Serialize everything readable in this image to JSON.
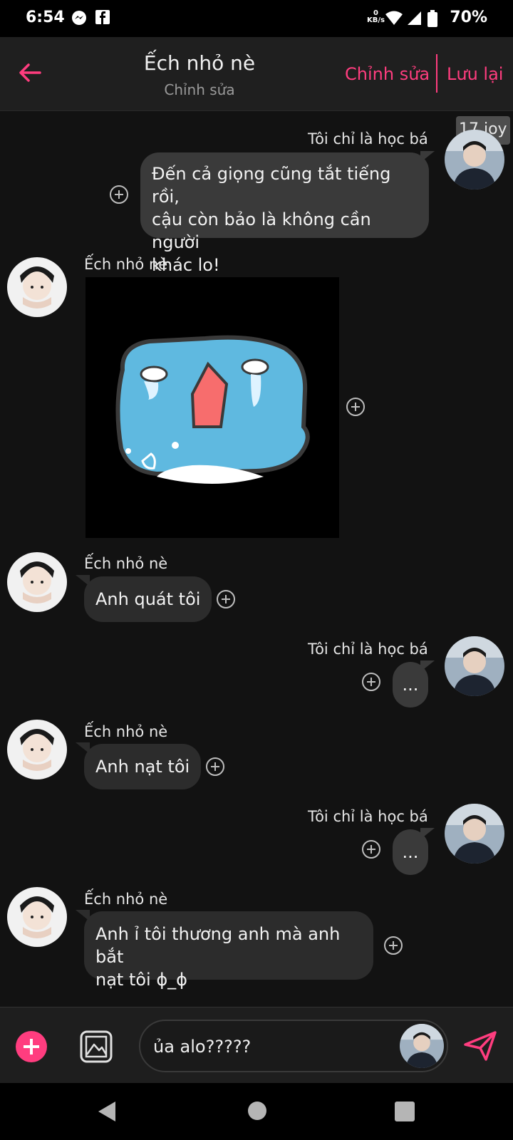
{
  "status_bar": {
    "time": "6:54",
    "net_value": "0",
    "net_unit": "KB/s",
    "battery": "70%"
  },
  "header": {
    "title": "Ếch nhỏ nè",
    "subtitle": "Chỉnh sửa",
    "edit_label": "Chỉnh sửa",
    "save_label": "Lưu lại"
  },
  "overlay_badge": "17 joy",
  "messages": [
    {
      "sender": "Tôi chỉ là học bá",
      "text_lines": [
        "Đến cả giọng cũng tắt tiếng rồi,",
        "cậu còn bảo là không cần người",
        "khác lo!"
      ]
    },
    {
      "sender": "Ếch nhỏ nè",
      "type": "sticker"
    },
    {
      "sender": "Ếch nhỏ nè",
      "text": "Anh quát tôi"
    },
    {
      "sender": "Tôi chỉ là học bá",
      "text": "..."
    },
    {
      "sender": "Ếch nhỏ nè",
      "text": "Anh nạt tôi"
    },
    {
      "sender": "Tôi chỉ là học bá",
      "text": "..."
    },
    {
      "sender": "Ếch nhỏ nè",
      "text_lines": [
        "Anh ỉ tôi thương anh mà anh bắt",
        "nạt tôi ɸ_ɸ"
      ]
    }
  ],
  "input": {
    "value": "ủa alo?????"
  },
  "colors": {
    "accent": "#ff3d7f",
    "background": "#121212",
    "bubble": "#3a3a3a"
  }
}
